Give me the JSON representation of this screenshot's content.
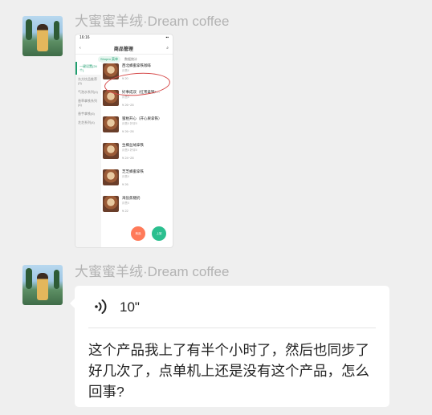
{
  "messages": [
    {
      "sender": "大蜜蜜羊绒·Dream coffee",
      "type": "image",
      "screenshot": {
        "status_time": "16:16",
        "nav_title": "商品管理",
        "tabs": [
          "Shopro 菜单",
          "数据统计"
        ],
        "sidebar": [
          "一键设置(24个)",
          "东方饮品推荐(3)",
          "气泡水系列(4)",
          "香草拿铁系列(4)",
          "香芋拿铁(6)",
          "芝芝系列(4)"
        ],
        "products": [
          {
            "name": "西北蜂蜜拿铁咖啡",
            "sub": "月售0",
            "price": "¥ 20"
          },
          {
            "name": "好事成双（红茶拿铁+...",
            "sub": "月售0",
            "price": "¥ 26~28"
          },
          {
            "name": "蜜柑开心（开心果拿铁）",
            "sub": "月售0 好评0",
            "price": "¥ 26~28"
          },
          {
            "name": "生椰丝绒拿铁",
            "sub": "月售0 好评0",
            "price": "¥ 24~28"
          },
          {
            "name": "芝芝蜂蜜拿铁",
            "sub": "月售0",
            "price": "¥ 26"
          },
          {
            "name": "海盐焦糖奶",
            "sub": "月售0",
            "price": "¥ 22"
          }
        ],
        "fab_labels": [
          "商品",
          "上架"
        ]
      }
    },
    {
      "sender": "大蜜蜜羊绒·Dream coffee",
      "type": "voice",
      "duration": "10\"",
      "transcript": "这个产品我上了有半个小时了，然后也同步了好几次了，点单机上还是没有这个产品，怎么回事?"
    }
  ],
  "colors": {
    "background": "#efefef",
    "sender_text": "#b3b3b3",
    "accent_green": "#1e9e6e",
    "annotation_red": "#d64a4a"
  },
  "icons": {
    "voice": "voice-wave-icon",
    "back": "chevron-left-icon"
  }
}
